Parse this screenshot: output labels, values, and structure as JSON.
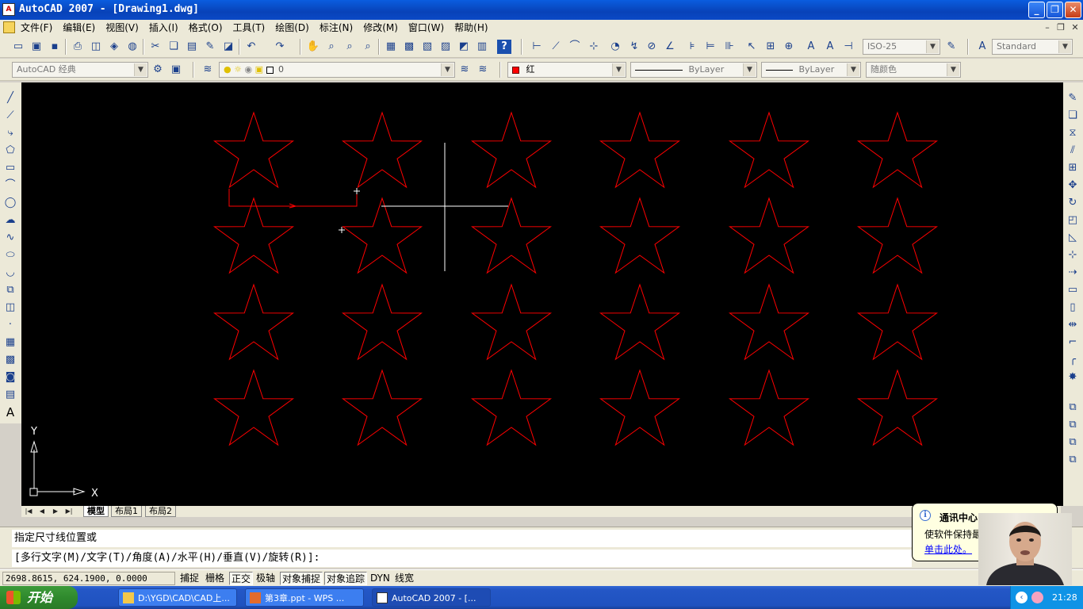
{
  "window": {
    "title": "AutoCAD 2007 - [Drawing1.dwg]",
    "min_glyph": "_",
    "max_glyph": "❐",
    "close_glyph": "✕"
  },
  "menu": {
    "items": [
      "文件(F)",
      "编辑(E)",
      "视图(V)",
      "插入(I)",
      "格式(O)",
      "工具(T)",
      "绘图(D)",
      "标注(N)",
      "修改(M)",
      "窗口(W)",
      "帮助(H)"
    ]
  },
  "toolbar": {
    "workspace": "AutoCAD 经典",
    "layer": "0",
    "dimstyle": "ISO-25",
    "textstyle": "Standard",
    "color": "红",
    "linetype": "ByLayer",
    "lineweight": "ByLayer",
    "plotstyle": "随颜色"
  },
  "canvas": {
    "background": "#000000",
    "star_color": "#ff0000",
    "ucs_y": "Y",
    "ucs_x": "X"
  },
  "layout_tabs": [
    "模型",
    "布局1",
    "布局2"
  ],
  "command": {
    "line1": "指定尺寸线位置或",
    "line2": "[多行文字(M)/文字(T)/角度(A)/水平(H)/垂直(V)/旋转(R)]:"
  },
  "status": {
    "coords": "2698.8615, 624.1900, 0.0000",
    "buttons": [
      "捕捉",
      "栅格",
      "正交",
      "极轴",
      "对象捕捉",
      "对象追踪",
      "DYN",
      "线宽"
    ],
    "on_buttons": [
      2,
      4,
      5
    ]
  },
  "balloon": {
    "title": "通讯中心",
    "text": "使软件保持最",
    "link": "单击此处。"
  },
  "taskbar": {
    "start_label": "开始",
    "tasks": [
      "D:\\YGD\\CAD\\CAD上...",
      "第3章.ppt - WPS ...",
      "AutoCAD 2007 - [..."
    ],
    "clock": "21:28"
  }
}
